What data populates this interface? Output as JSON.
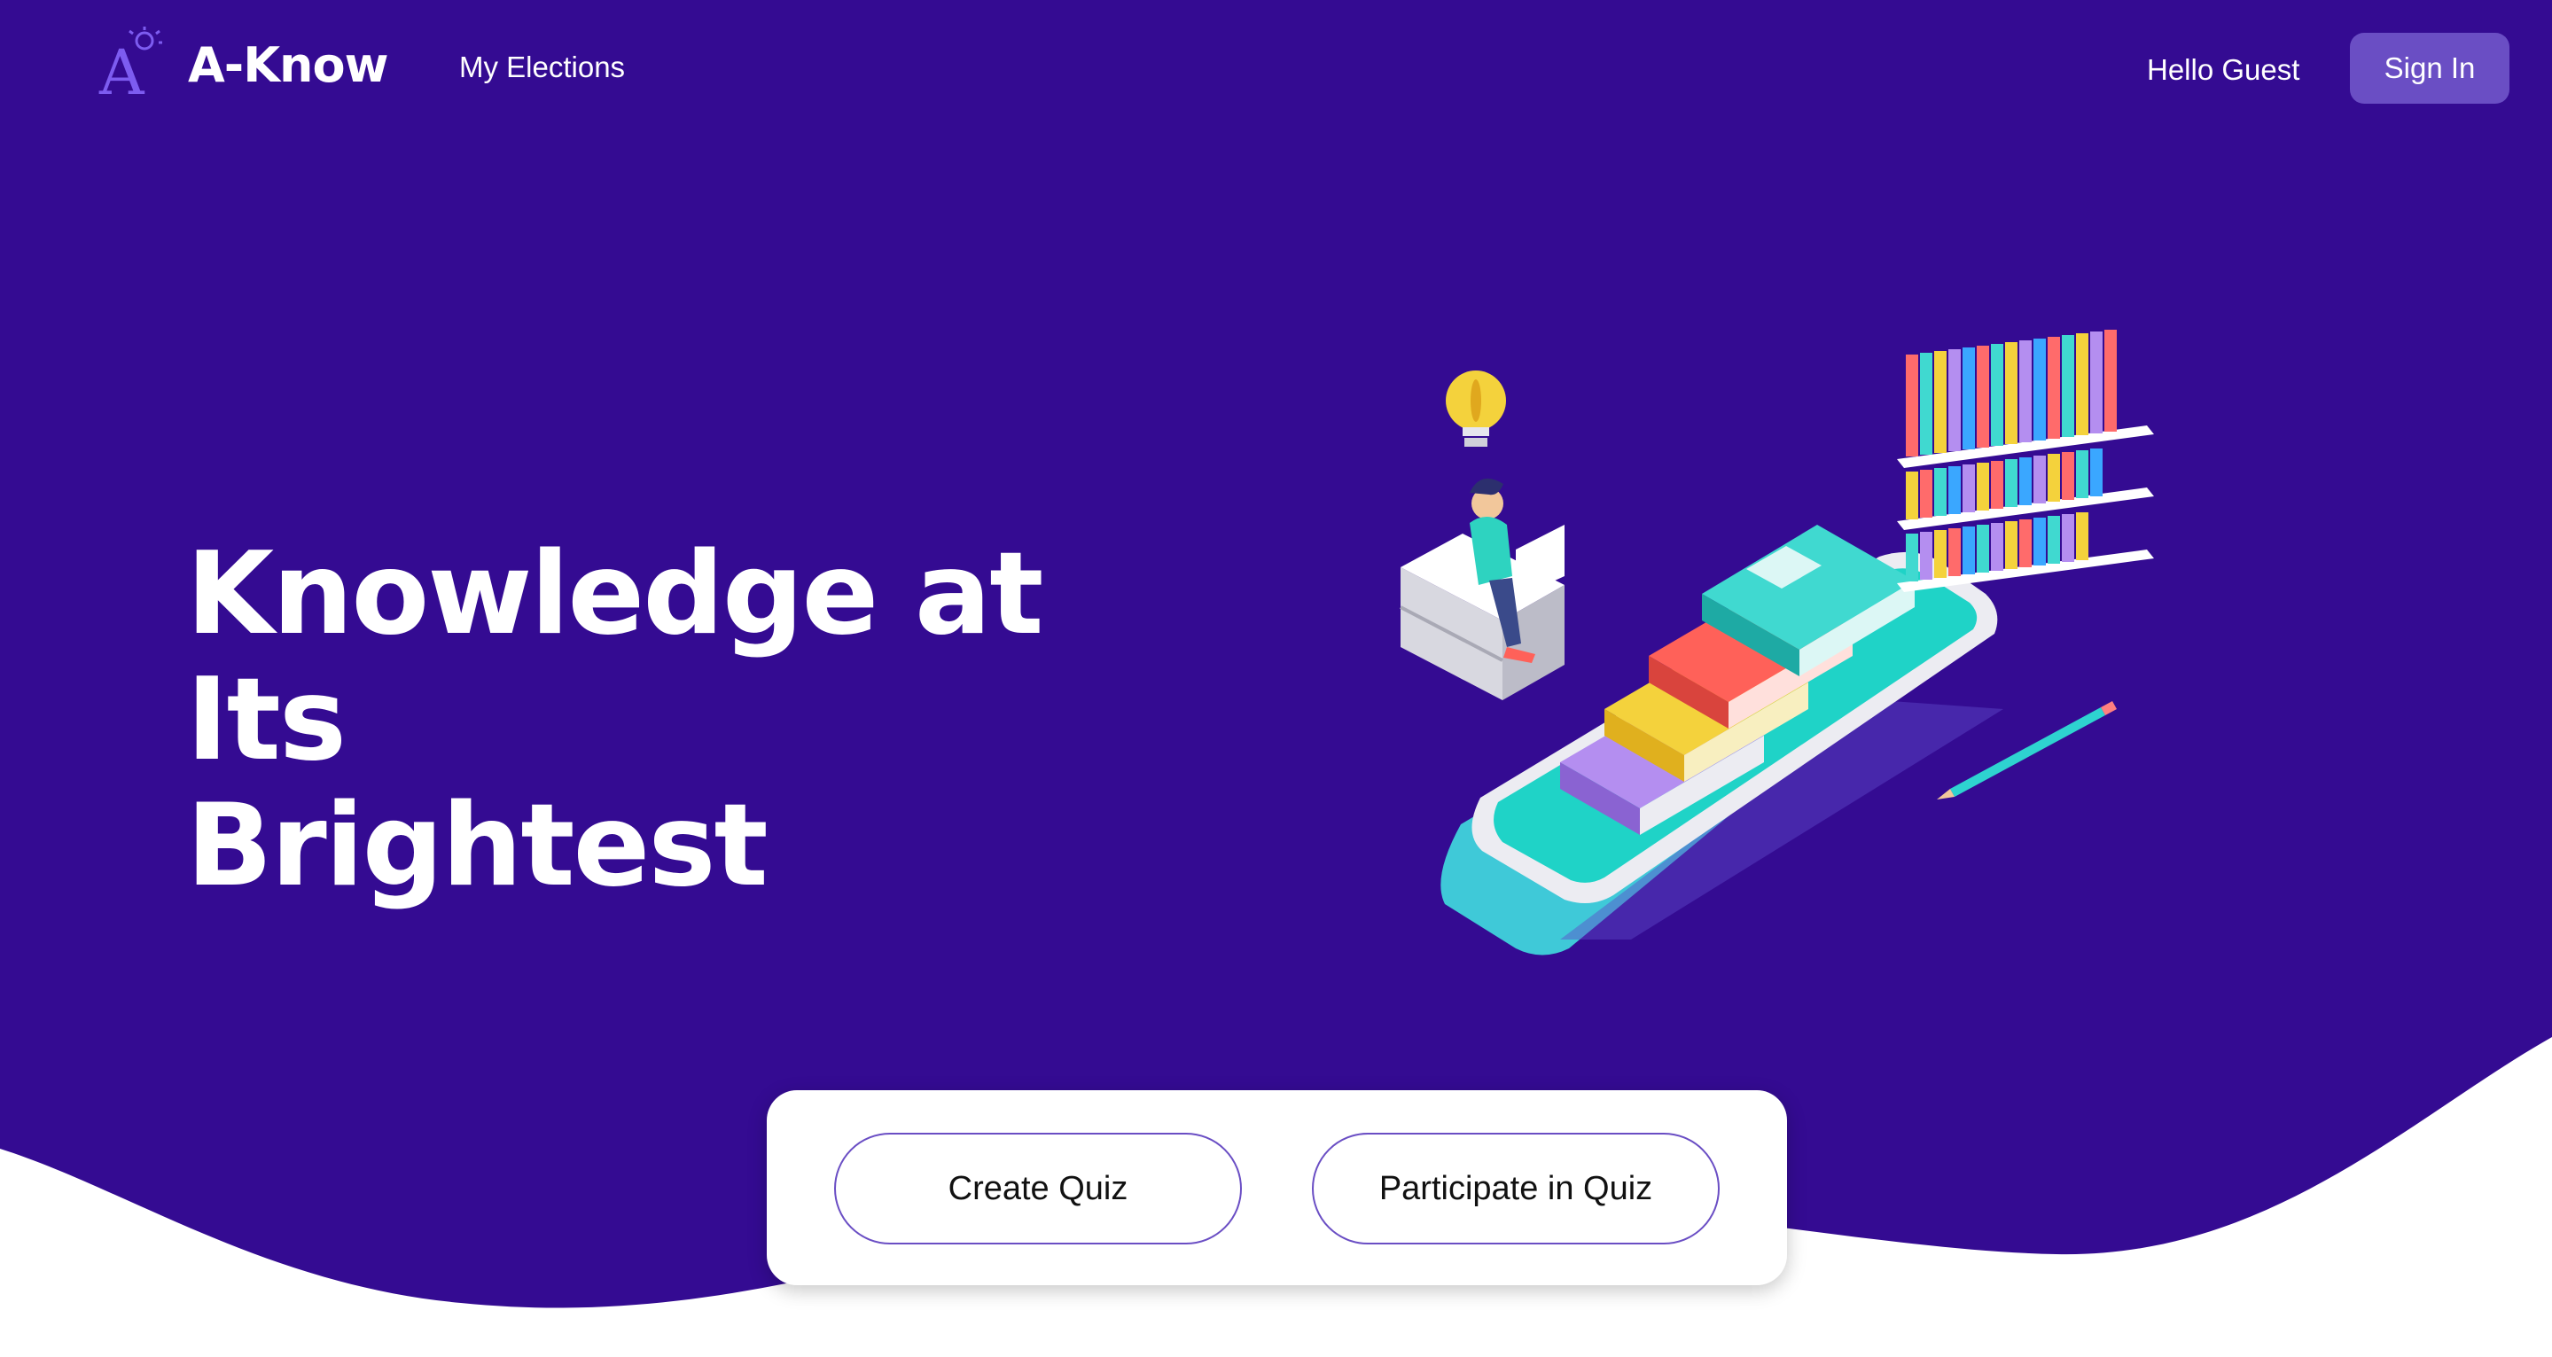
{
  "colors": {
    "hero_background": "#340b92",
    "accent": "#6a4ec4",
    "text_on_hero": "#ffffff"
  },
  "navbar": {
    "brand": "A-Know",
    "logo_icon": "letter-a-with-lightbulb-icon",
    "links": [
      {
        "label": "My Elections"
      }
    ],
    "greeting": "Hello Guest",
    "sign_in_label": "Sign In"
  },
  "hero": {
    "title_line1": "Knowledge at Its",
    "title_line2": "Brightest",
    "illustration": "isometric-phone-books-reader-illustration"
  },
  "actions": {
    "create_quiz_label": "Create Quiz",
    "participate_quiz_label": "Participate in Quiz"
  }
}
